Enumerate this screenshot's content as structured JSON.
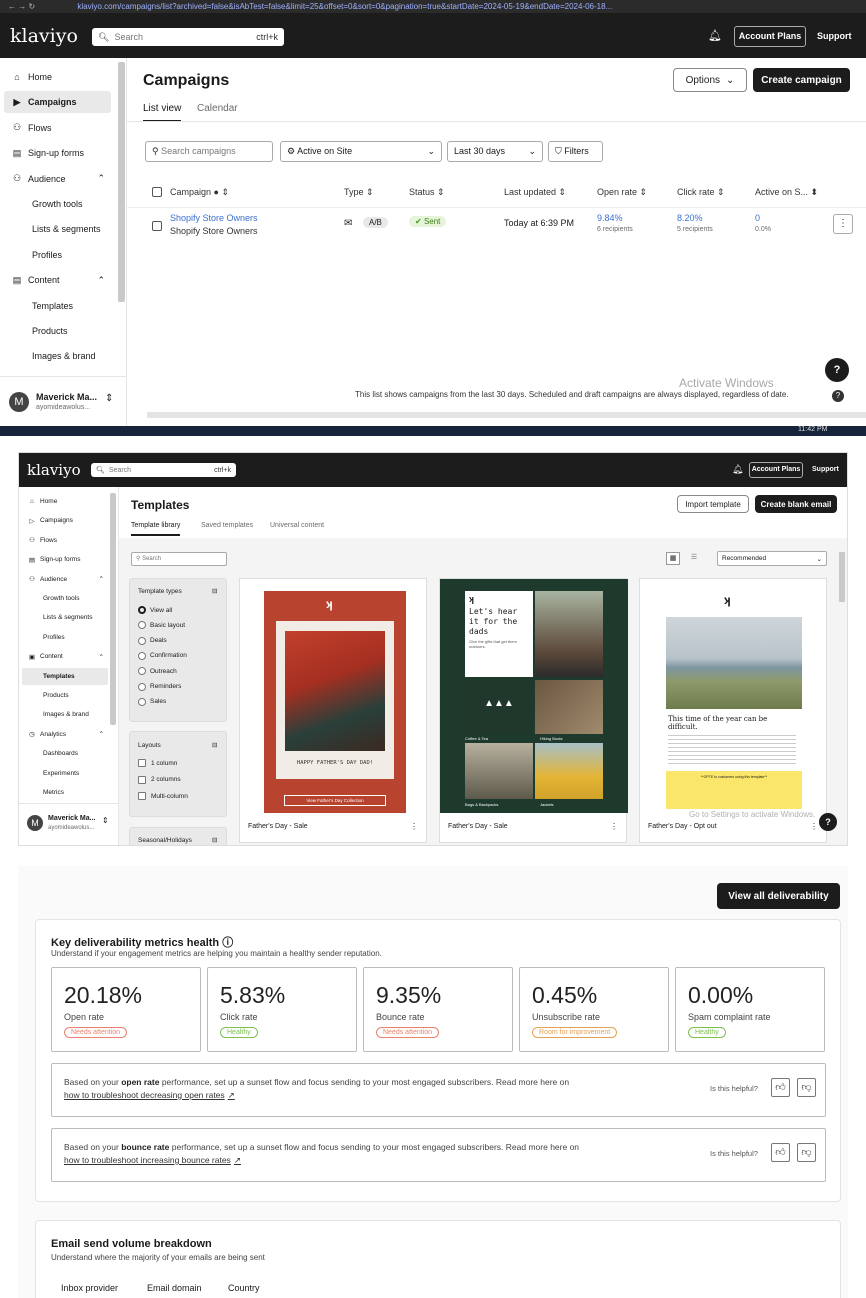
{
  "browser": {
    "url": "klaviyo.com/campaigns/list?archived=false&isAbTest=false&limit=25&offset=0&sort=0&pagination=true&startDate=2024-05-19&endDate=2024-06-18..."
  },
  "s1": {
    "logo": "klaviyo",
    "search_placeholder": "Search",
    "search_shortcut": "ctrl+k",
    "account_plans": "Account Plans",
    "support": "Support",
    "nav": [
      {
        "label": "Home",
        "icon": "⌂"
      },
      {
        "label": "Campaigns",
        "icon": "▶"
      },
      {
        "label": "Flows",
        "icon": "⚇"
      },
      {
        "label": "Sign-up forms",
        "icon": "▤"
      },
      {
        "label": "Audience",
        "icon": "⚇"
      },
      {
        "label": "Growth tools",
        "icon": ""
      },
      {
        "label": "Lists & segments",
        "icon": ""
      },
      {
        "label": "Profiles",
        "icon": ""
      },
      {
        "label": "Content",
        "icon": "▤"
      },
      {
        "label": "Templates",
        "icon": ""
      },
      {
        "label": "Products",
        "icon": ""
      },
      {
        "label": "Images & brand",
        "icon": ""
      }
    ],
    "user": {
      "initial": "M",
      "name": "Maverick Ma...",
      "email": "ayomideawolus..."
    },
    "title": "Campaigns",
    "options": "Options",
    "create": "Create campaign",
    "tabs": [
      "List view",
      "Calendar"
    ],
    "search_campaigns": "Search campaigns",
    "filter_site": "Active on Site",
    "filter_date": "Last 30 days",
    "filters": "Filters",
    "columns": [
      "Campaign",
      "Type",
      "Status",
      "Last updated",
      "Open rate",
      "Click rate",
      "Active on S..."
    ],
    "row": {
      "name": "Shopify Store Owners",
      "sub": "Shopify Store Owners",
      "type": "A/B",
      "status": "Sent",
      "updated": "Today at 6:39 PM",
      "open": "9.84%",
      "open_sub": "6 recipients",
      "click": "8.20%",
      "click_sub": "5 recipients",
      "active": "0",
      "active_sub": "0.0%"
    },
    "footer": "This list shows campaigns from the last 30 days. Scheduled and draft campaigns are always displayed, regardless of date.",
    "activate": "Activate Windows",
    "time": "11:42 PM"
  },
  "s2": {
    "logo": "klaviyo",
    "search_placeholder": "Search",
    "search_shortcut": "ctrl+k",
    "account_plans": "Account Plans",
    "support": "Support",
    "nav": [
      {
        "label": "Home",
        "icon": "⌂"
      },
      {
        "label": "Campaigns",
        "icon": "▷"
      },
      {
        "label": "Flows",
        "icon": "⚇"
      },
      {
        "label": "Sign-up forms",
        "icon": "▤"
      },
      {
        "label": "Audience",
        "icon": "⚇"
      },
      {
        "label": "Growth tools",
        "icon": ""
      },
      {
        "label": "Lists & segments",
        "icon": ""
      },
      {
        "label": "Profiles",
        "icon": ""
      },
      {
        "label": "Content",
        "icon": "▣"
      },
      {
        "label": "Templates",
        "icon": ""
      },
      {
        "label": "Products",
        "icon": ""
      },
      {
        "label": "Images & brand",
        "icon": ""
      },
      {
        "label": "Analytics",
        "icon": "◷"
      },
      {
        "label": "Dashboards",
        "icon": ""
      },
      {
        "label": "Experiments",
        "icon": ""
      },
      {
        "label": "Metrics",
        "icon": ""
      }
    ],
    "user": {
      "initial": "M",
      "name": "Maverick Ma...",
      "email": "ayomideawolus..."
    },
    "title": "Templates",
    "import": "Import template",
    "create": "Create blank email",
    "tabs": [
      "Template library",
      "Saved templates",
      "Universal content"
    ],
    "search": "Search",
    "sort": "Recommended",
    "types_title": "Template types",
    "types": [
      "View all",
      "Basic layout",
      "Deals",
      "Confirmation",
      "Outreach",
      "Reminders",
      "Sales"
    ],
    "layouts_title": "Layouts",
    "layouts": [
      "1 column",
      "2 columns",
      "Multi-column"
    ],
    "seasonal": "Seasonal/Holidays",
    "cards": [
      {
        "name": "Father's Day - Sale",
        "caption": "HAPPY FATHER'S DAY DAD!",
        "cta": "View Father's Day Collection"
      },
      {
        "name": "Father's Day - Sale",
        "headline": "Let's hear it for the dads",
        "sub": "Give the gifts that get them outdoors.",
        "tags": [
          "Coffee & Tea",
          "Hiking Boots",
          "Bags & Backpacks",
          "Jackets"
        ]
      },
      {
        "name": "Father's Day - Opt out",
        "headline": "This time of the year can be difficult.",
        "notice": "**OPTE to customers using this template**"
      }
    ],
    "activate": "Go to Settings to activate Windows."
  },
  "s3": {
    "view_all": "View all deliverability",
    "title": "Key deliverability metrics health",
    "subtitle": "Understand if your engagement metrics are helping you maintain a healthy sender reputation.",
    "metrics": [
      {
        "value": "20.18%",
        "label": "Open rate",
        "badge": "Needs attention",
        "color": "#e8826f"
      },
      {
        "value": "5.83%",
        "label": "Click rate",
        "badge": "Healthy",
        "color": "#7cbf4d"
      },
      {
        "value": "9.35%",
        "label": "Bounce rate",
        "badge": "Needs attention",
        "color": "#e8826f"
      },
      {
        "value": "0.45%",
        "label": "Unsubscribe rate",
        "badge": "Room for improvement",
        "color": "#e2a256"
      },
      {
        "value": "0.00%",
        "label": "Spam complaint rate",
        "badge": "Healthy",
        "color": "#7cbf4d"
      }
    ],
    "tips": [
      {
        "pre": "Based on your ",
        "bold": "open rate",
        "post": " performance, set up a sunset flow and focus sending to your most engaged subscribers. Read more here on",
        "link": "how to troubleshoot decreasing open rates"
      },
      {
        "pre": "Based on your ",
        "bold": "bounce rate",
        "post": " performance, set up a sunset flow and focus sending to your most engaged subscribers. Read more here on",
        "link": "how to troubleshoot increasing bounce rates"
      }
    ],
    "helpful": "Is this helpful?",
    "volume_title": "Email send volume breakdown",
    "volume_sub": "Understand where the majority of your emails are being sent",
    "volume_tabs": [
      "Inbox provider",
      "Email domain",
      "Country"
    ]
  }
}
